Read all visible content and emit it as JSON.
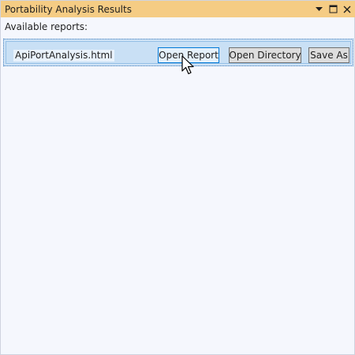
{
  "window": {
    "title": "Portability Analysis Results",
    "title_bar_color": "#f5cc84",
    "controls": [
      {
        "icon": "dropdown-arrow-icon"
      },
      {
        "icon": "maximize-icon"
      },
      {
        "icon": "close-icon"
      }
    ]
  },
  "main": {
    "section_label": "Available reports:",
    "reports": [
      {
        "file_name": "ApiPortAnalysis.html",
        "buttons": {
          "open_report": "Open Report",
          "open_directory": "Open Directory",
          "save_as": "Save As"
        }
      }
    ]
  },
  "cursor": {
    "icon": "arrow-cursor-icon"
  }
}
